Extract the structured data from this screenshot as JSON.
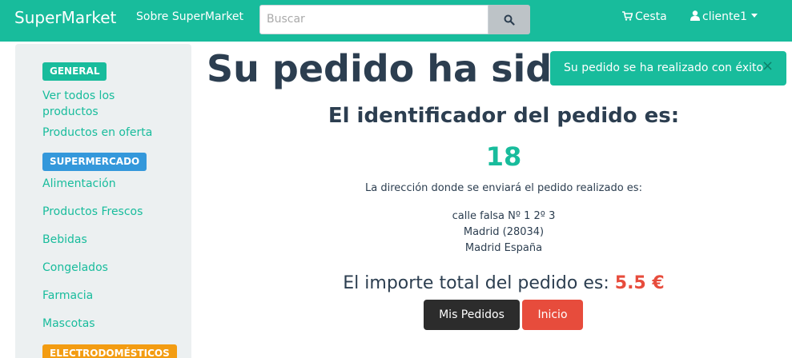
{
  "navbar": {
    "brand": "SuperMarket",
    "about_label": "Sobre SuperMarket",
    "search_placeholder": "Buscar",
    "cart_label": "Cesta",
    "user_label": "cliente1"
  },
  "sidebar": {
    "general_badge": "GENERAL",
    "general_items": [
      "Ver todos los productos",
      "Productos en oferta"
    ],
    "supermarket_badge": "SUPERMERCADO",
    "supermarket_items": [
      "Alimentación",
      "Productos Frescos",
      "Bebidas",
      "Congelados",
      "Farmacia",
      "Mascotas"
    ],
    "electro_badge": "ELECTRODOMÉSTICOS"
  },
  "main": {
    "title": "Su pedido ha sido rea",
    "order_heading": "El identificador del pedido es:",
    "order_id": "18",
    "address_label": "La dirección donde se enviará el pedido realizado es:",
    "address_lines": [
      "calle falsa Nº 1 2º 3",
      "Madrid (28034)",
      "Madrid España"
    ],
    "total_label": "El importe total del pedido es:",
    "total_amount": "5.5 €",
    "my_orders_button": "Mis Pedidos",
    "home_button": "Inicio"
  },
  "toast": {
    "message": "Su pedido se ha realizado con éxito",
    "close_symbol": "×"
  },
  "colors": {
    "brand_green": "#18bc9c",
    "navy": "#2c3e50",
    "danger": "#e74c3c",
    "info": "#3498db",
    "warning": "#f39c12"
  },
  "icons": {
    "search": "search-icon",
    "cart": "cart-icon",
    "user": "user-icon"
  }
}
